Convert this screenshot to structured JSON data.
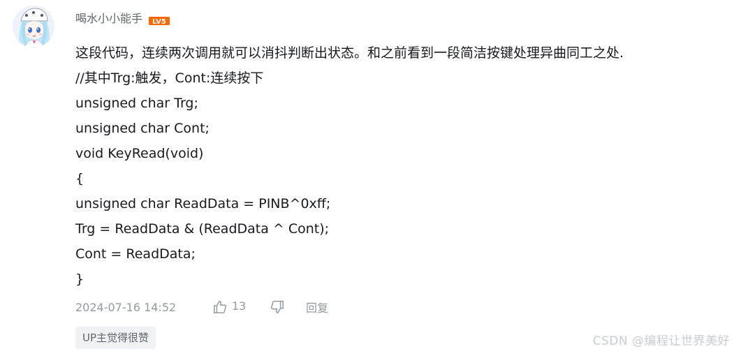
{
  "comment": {
    "username": "喝水小小能手",
    "level": "LV5",
    "level_color": "#ff6600",
    "avatar_icon": "anime-girl-avatar",
    "lines": [
      "这段代码，连续两次调用就可以消抖判断出状态。和之前看到一段简洁按键处理异曲同工之处.",
      "//其中Trg:触发，Cont:连续按下",
      "unsigned char Trg;",
      "unsigned char Cont;",
      "void KeyRead(void)",
      "{",
      "unsigned char ReadData = PINB^0xff;",
      "Trg = ReadData & (ReadData ^ Cont);",
      "Cont = ReadData;",
      "}"
    ],
    "timestamp": "2024-07-16 14:52",
    "like_count": "13",
    "reply_label": "回复",
    "up_tag": "UP主觉得很赞"
  },
  "watermark": "CSDN @编程让世界美好"
}
